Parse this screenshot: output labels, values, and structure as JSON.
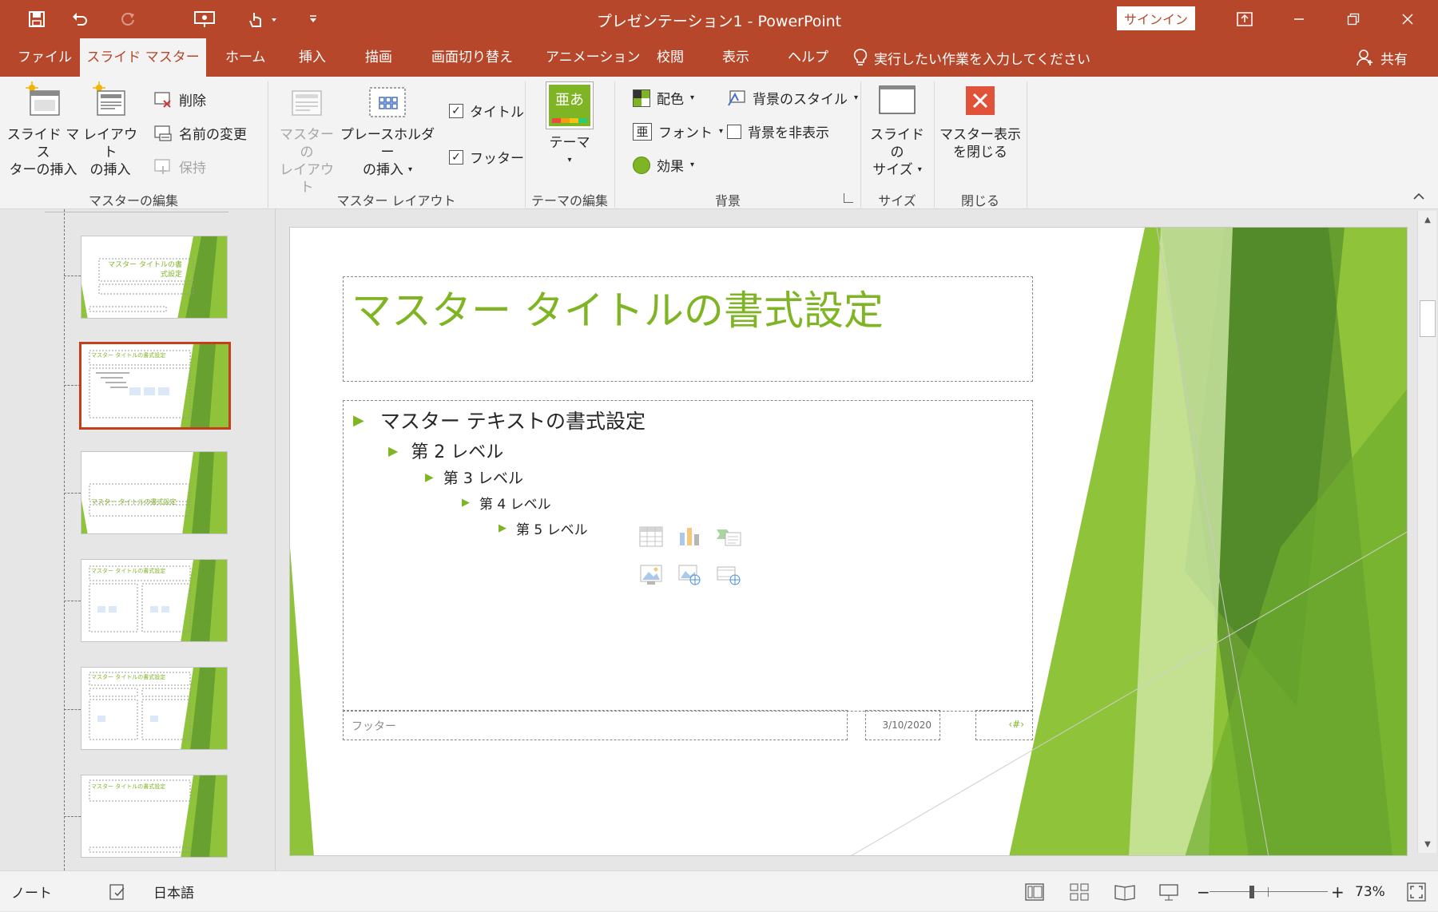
{
  "title_bar": {
    "document_title": "プレゼンテーション1  -  PowerPoint",
    "signin_label": "サインイン"
  },
  "tabs": [
    {
      "label": "ファイル"
    },
    {
      "label": "スライド マスター"
    },
    {
      "label": "ホーム"
    },
    {
      "label": "挿入"
    },
    {
      "label": "描画"
    },
    {
      "label": "画面切り替え"
    },
    {
      "label": "アニメーション"
    },
    {
      "label": "校閲"
    },
    {
      "label": "表示"
    },
    {
      "label": "ヘルプ"
    }
  ],
  "tell_me": "実行したい作業を入力してください",
  "share_label": "共有",
  "ribbon": {
    "edit_master": {
      "label": "マスターの編集",
      "insert_slide_master": [
        "スライド マス",
        "ターの挿入"
      ],
      "insert_layout": [
        "レイアウト",
        "の挿入"
      ],
      "delete": "削除",
      "rename": "名前の変更",
      "preserve": "保持"
    },
    "master_layout": {
      "label": "マスター レイアウト",
      "master_layout_btn": [
        "マスターの",
        "レイアウト"
      ],
      "insert_placeholder": [
        "プレースホルダー",
        "の挿入"
      ],
      "title_check": "タイトル",
      "footer_check": "フッター"
    },
    "edit_theme": {
      "label": "テーマの編集",
      "themes": "テーマ",
      "theme_icon_text": "亜あ"
    },
    "background": {
      "label": "背景",
      "colors": "配色",
      "fonts": "フォント",
      "fonts_icon_text": "亜",
      "effects": "効果",
      "bg_styles": "背景のスタイル",
      "hide_bg": "背景を非表示"
    },
    "size": {
      "label": "サイズ",
      "slide_size": [
        "スライドの",
        "サイズ"
      ]
    },
    "close": {
      "label": "閉じる",
      "close_master": [
        "マスター表示",
        "を閉じる"
      ]
    }
  },
  "slide": {
    "title": "マスター タイトルの書式設定",
    "levels": [
      "マスター テキストの書式設定",
      "第 2 レベル",
      "第 3 レベル",
      "第 4 レベル",
      "第 5 レベル"
    ],
    "footer": "フッター",
    "date": "3/10/2020",
    "page_number": "‹#›"
  },
  "thumbnails": {
    "master_title": "マスター タイトルの書式設定"
  },
  "status": {
    "notes": "ノート",
    "language": "日本語",
    "zoom": "73%"
  },
  "colors": {
    "accent": "#b7472a",
    "theme_green": "#7fb524",
    "selected_border": "#c43e1c"
  }
}
